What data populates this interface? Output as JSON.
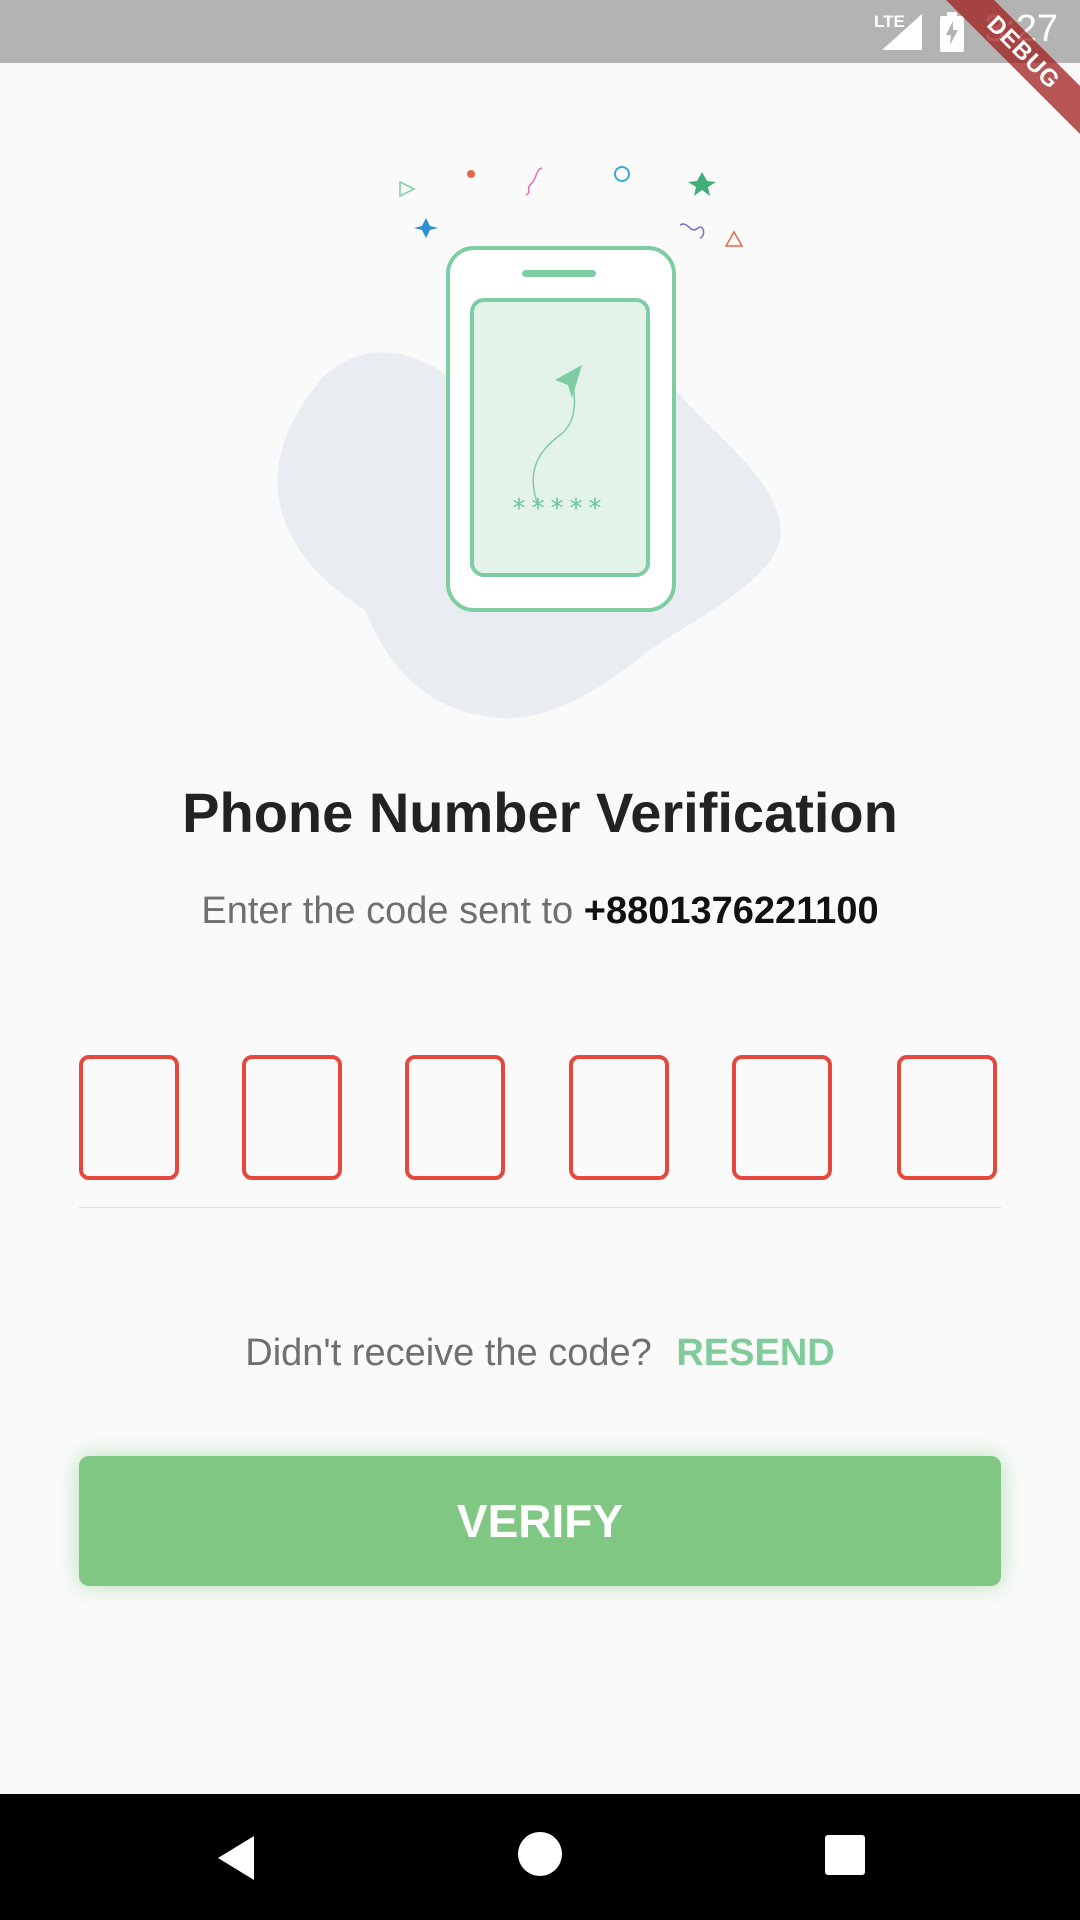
{
  "status_bar": {
    "network_label": "LTE",
    "time": "3:27",
    "icons": [
      "signal-icon",
      "battery-charging-icon"
    ]
  },
  "debug_banner": {
    "label": "DEBUG"
  },
  "illustration": {
    "icon": "phone-verification-illustration",
    "code_mask": "*****"
  },
  "page": {
    "title": "Phone Number Verification",
    "subtitle_prefix": "Enter the code sent to ",
    "phone_number": "+8801376221100"
  },
  "otp": {
    "length": 6,
    "values": [
      "",
      "",
      "",
      "",
      "",
      ""
    ],
    "error_color": "#e5493d"
  },
  "resend": {
    "prompt": "Didn't receive the code?",
    "action_label": "RESEND",
    "action_color": "#7fcc9a"
  },
  "verify_button": {
    "label": "VERIFY",
    "color": "#80c784"
  },
  "nav_bar": {
    "icons": [
      "back-icon",
      "home-icon",
      "recents-icon"
    ]
  }
}
